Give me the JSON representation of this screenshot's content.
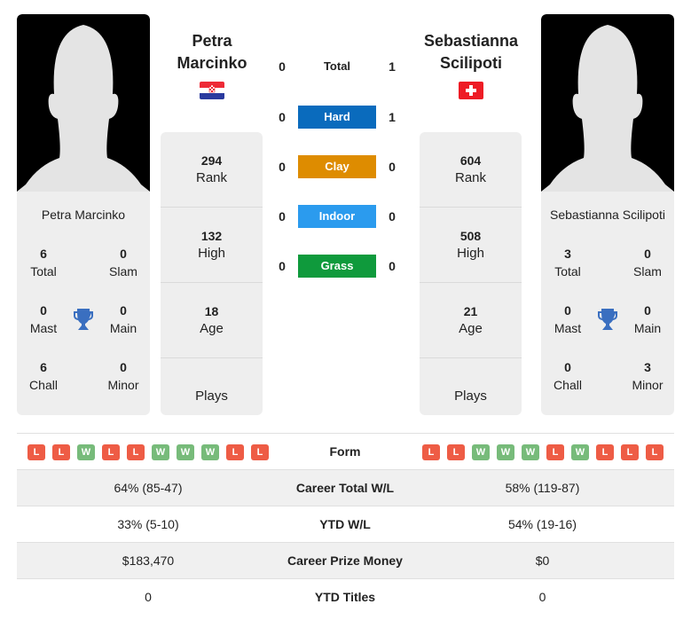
{
  "colors": {
    "hard": "#0a6bbd",
    "clay": "#de8c00",
    "indoor": "#2b9bee",
    "grass": "#0f9a3c",
    "win": "#77bb7a",
    "loss": "#ee5c45",
    "trophy": "#3a6fc0"
  },
  "player1": {
    "name_line1": "Petra",
    "name_line2": "Marcinko",
    "full_name": "Petra Marcinko",
    "flag": "croatia-flag",
    "rank": "294",
    "rank_label": "Rank",
    "high": "132",
    "high_label": "High",
    "age": "18",
    "age_label": "Age",
    "plays_label": "Plays",
    "titles": {
      "total": "6",
      "total_label": "Total",
      "slam": "0",
      "slam_label": "Slam",
      "mast": "0",
      "mast_label": "Mast",
      "main": "0",
      "main_label": "Main",
      "chall": "6",
      "chall_label": "Chall",
      "minor": "0",
      "minor_label": "Minor"
    },
    "form": [
      "L",
      "L",
      "W",
      "L",
      "L",
      "W",
      "W",
      "W",
      "L",
      "L"
    ]
  },
  "player2": {
    "name_line1": "Sebastianna",
    "name_line2": "Scilipoti",
    "full_name": "Sebastianna Scilipoti",
    "flag": "switzerland-flag",
    "rank": "604",
    "rank_label": "Rank",
    "high": "508",
    "high_label": "High",
    "age": "21",
    "age_label": "Age",
    "plays_label": "Plays",
    "titles": {
      "total": "3",
      "total_label": "Total",
      "slam": "0",
      "slam_label": "Slam",
      "mast": "0",
      "mast_label": "Mast",
      "main": "0",
      "main_label": "Main",
      "chall": "0",
      "chall_label": "Chall",
      "minor": "3",
      "minor_label": "Minor"
    },
    "form": [
      "L",
      "L",
      "W",
      "W",
      "W",
      "L",
      "W",
      "L",
      "L",
      "L"
    ]
  },
  "h2h": [
    {
      "label": "Total",
      "p1": "0",
      "p2": "1",
      "surface": "total"
    },
    {
      "label": "Hard",
      "p1": "0",
      "p2": "1",
      "surface": "hard"
    },
    {
      "label": "Clay",
      "p1": "0",
      "p2": "0",
      "surface": "clay"
    },
    {
      "label": "Indoor",
      "p1": "0",
      "p2": "0",
      "surface": "indoor"
    },
    {
      "label": "Grass",
      "p1": "0",
      "p2": "0",
      "surface": "grass"
    }
  ],
  "table": {
    "form_label": "Form",
    "rows": [
      {
        "label": "Career Total W/L",
        "p1": "64% (85-47)",
        "p2": "58% (119-87)"
      },
      {
        "label": "YTD W/L",
        "p1": "33% (5-10)",
        "p2": "54% (19-16)"
      },
      {
        "label": "Career Prize Money",
        "p1": "$183,470",
        "p2": "$0"
      },
      {
        "label": "YTD Titles",
        "p1": "0",
        "p2": "0"
      }
    ]
  }
}
